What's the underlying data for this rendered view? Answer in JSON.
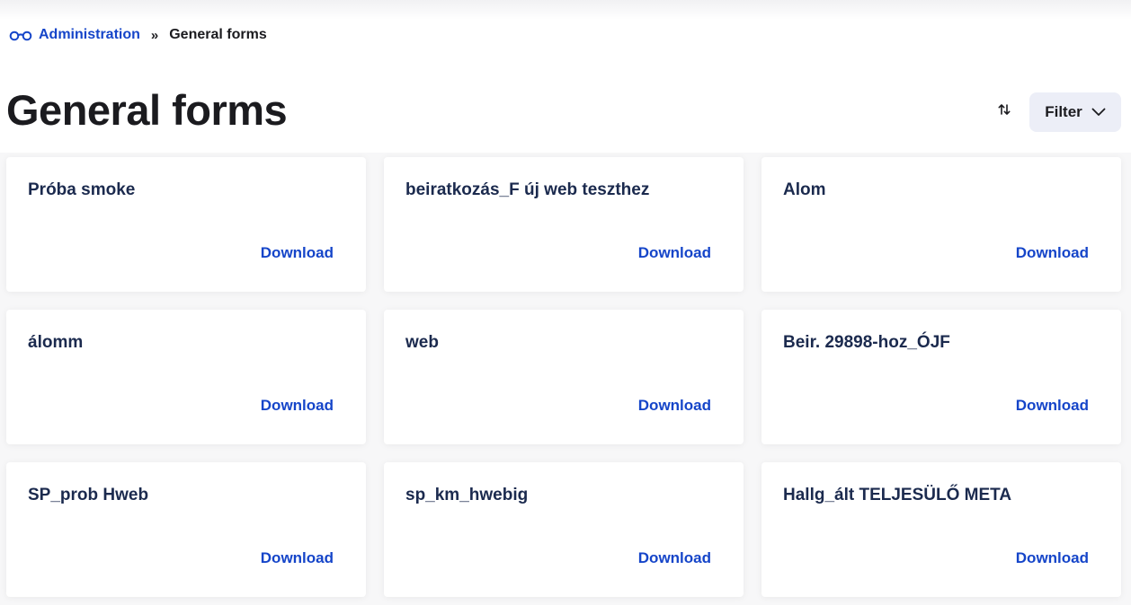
{
  "breadcrumb": {
    "icon": "glasses-icon",
    "parent": "Administration",
    "separator": "»",
    "current": "General forms"
  },
  "page": {
    "title": "General forms"
  },
  "toolbar": {
    "sort_icon": "sort-arrows-icon",
    "filter_label": "Filter",
    "filter_icon": "chevron-down-icon"
  },
  "colors": {
    "link": "#1545c9",
    "card_title": "#1b2a4e",
    "filter_bg": "#eceef7"
  },
  "forms": [
    {
      "title": "Próba smoke",
      "action": "Download"
    },
    {
      "title": "beiratkozás_F új web teszthez",
      "action": "Download"
    },
    {
      "title": "Alom",
      "action": "Download"
    },
    {
      "title": "álomm",
      "action": "Download"
    },
    {
      "title": "web",
      "action": "Download"
    },
    {
      "title": "Beir. 29898-hoz_ÓJF",
      "action": "Download"
    },
    {
      "title": "SP_prob Hweb",
      "action": "Download"
    },
    {
      "title": "sp_km_hwebig",
      "action": "Download"
    },
    {
      "title": "Hallg_ált TELJESÜLŐ META",
      "action": "Download"
    }
  ]
}
